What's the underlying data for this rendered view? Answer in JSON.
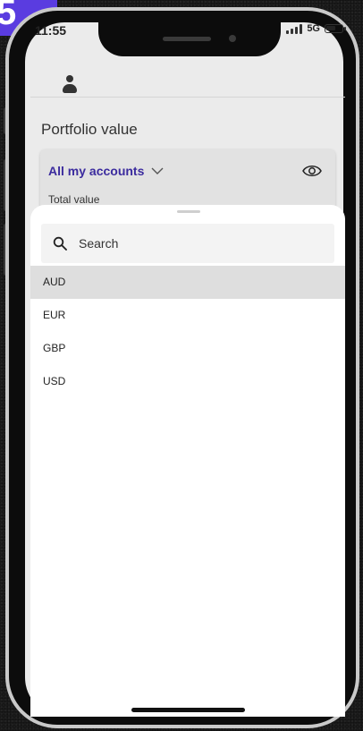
{
  "step_badge": "5",
  "status_bar": {
    "time": "11:55",
    "network": "5G"
  },
  "header": {
    "avatar_icon": "user-icon"
  },
  "portfolio": {
    "title": "Portfolio value",
    "account_selector_label": "All my accounts",
    "total_value_label": "Total value"
  },
  "currency_sheet": {
    "search_placeholder": "Search",
    "currencies": [
      "AUD",
      "EUR",
      "GBP",
      "USD"
    ],
    "selected": "AUD"
  },
  "colors": {
    "accent": "#3b2b9e",
    "badge": "#5a3ce0",
    "selected_row": "#dedede"
  }
}
